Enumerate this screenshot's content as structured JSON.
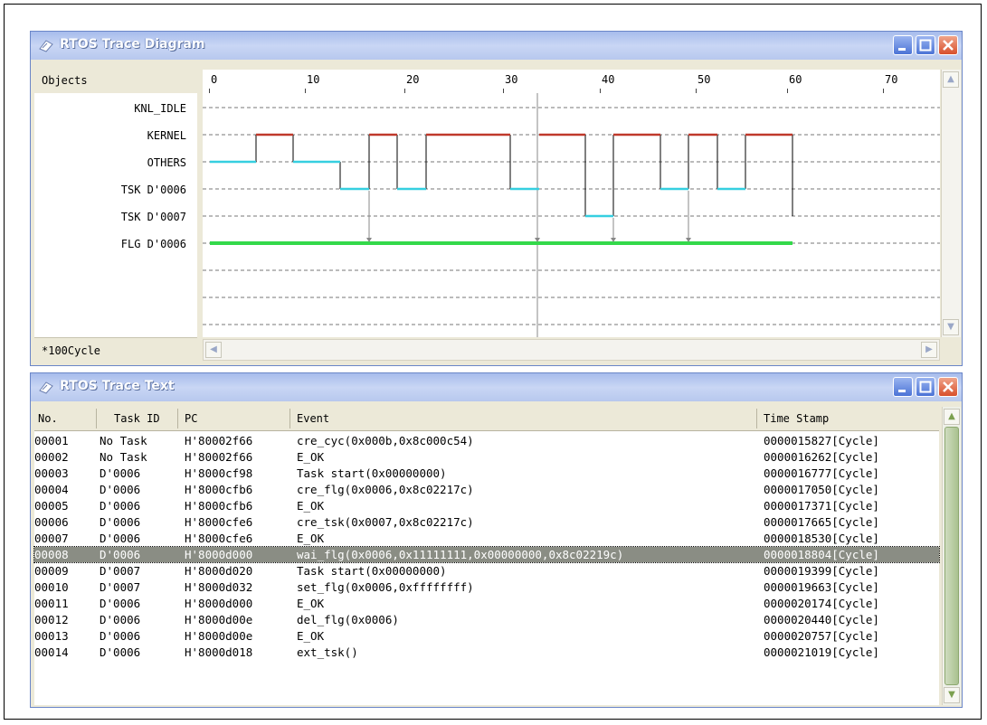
{
  "diagram": {
    "title": "RTOS Trace Diagram",
    "objects_header": "Objects",
    "cycle_unit": "*100Cycle",
    "objects": [
      "KNL_IDLE",
      "KERNEL",
      "OTHERS",
      "TSK D'0006",
      "TSK D'0007",
      "FLG D'0006"
    ],
    "ruler": [
      "0",
      "10",
      "20",
      "30",
      "40",
      "50",
      "60",
      "70"
    ]
  },
  "text_view": {
    "title": "RTOS Trace Text",
    "columns": [
      "No.",
      "Task ID",
      "PC",
      "Event",
      "Time Stamp"
    ],
    "selected_row": "00008",
    "rows": [
      [
        "00001",
        "No Task",
        "H'80002f66",
        "cre_cyc(0x000b,0x8c000c54)",
        "0000015827[Cycle]"
      ],
      [
        "00002",
        "No Task",
        "H'80002f66",
        "E_OK",
        "0000016262[Cycle]"
      ],
      [
        "00003",
        "D'0006",
        "H'8000cf98",
        "Task start(0x00000000)",
        "0000016777[Cycle]"
      ],
      [
        "00004",
        "D'0006",
        "H'8000cfb6",
        "cre_flg(0x0006,0x8c02217c)",
        "0000017050[Cycle]"
      ],
      [
        "00005",
        "D'0006",
        "H'8000cfb6",
        "E_OK",
        "0000017371[Cycle]"
      ],
      [
        "00006",
        "D'0006",
        "H'8000cfe6",
        "cre_tsk(0x0007,0x8c02217c)",
        "0000017665[Cycle]"
      ],
      [
        "00007",
        "D'0006",
        "H'8000cfe6",
        "E_OK",
        "0000018530[Cycle]"
      ],
      [
        "00008",
        "D'0006",
        "H'8000d000",
        "wai_flg(0x0006,0x11111111,0x00000000,0x8c02219c)",
        "0000018804[Cycle]"
      ],
      [
        "00009",
        "D'0007",
        "H'8000d020",
        "Task start(0x00000000)",
        "0000019399[Cycle]"
      ],
      [
        "00010",
        "D'0007",
        "H'8000d032",
        "set_flg(0x0006,0xffffffff)",
        "0000019663[Cycle]"
      ],
      [
        "00011",
        "D'0006",
        "H'8000d000",
        "E_OK",
        "0000020174[Cycle]"
      ],
      [
        "00012",
        "D'0006",
        "H'8000d00e",
        "del_flg(0x0006)",
        "0000020440[Cycle]"
      ],
      [
        "00013",
        "D'0006",
        "H'8000d00e",
        "E_OK",
        "0000020757[Cycle]"
      ],
      [
        "00014",
        "D'0006",
        "H'8000d018",
        "ext_tsk()",
        "0000021019[Cycle]"
      ]
    ]
  },
  "colors": {
    "kernel_segment": "#c0392b",
    "others_segment": "#36cfe0",
    "flag_line": "#33d94a"
  }
}
